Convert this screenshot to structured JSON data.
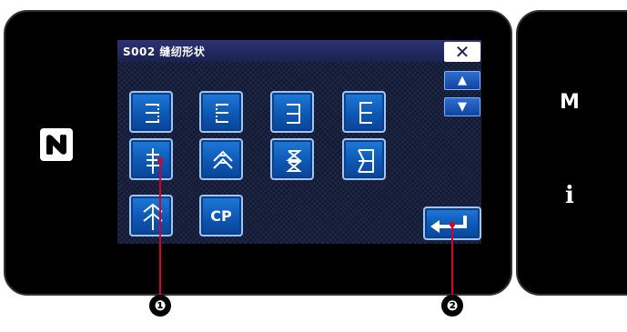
{
  "screen": {
    "title": "S002 缝纫形状",
    "close_label": "✕",
    "scroll_up": "▲",
    "scroll_down": "▼",
    "cp_label": "CP"
  },
  "patterns": [
    {
      "icon": "zigzag-pattern-1"
    },
    {
      "icon": "zigzag-pattern-2"
    },
    {
      "icon": "straight-bartack-pattern-1"
    },
    {
      "icon": "straight-bartack-pattern-2"
    },
    {
      "icon": "cross-bartack-pattern"
    },
    {
      "icon": "chevron-pattern"
    },
    {
      "icon": "double-triangle-pattern"
    },
    {
      "icon": "trapezoid-pattern"
    },
    {
      "icon": "arrow-pattern"
    },
    {
      "icon": "cp-pattern"
    }
  ],
  "side_keys": {
    "mode": "M",
    "info": "i"
  },
  "callouts": [
    "❶",
    "❷"
  ],
  "colors": {
    "screen_bg": "#121a36",
    "button_blue": "#0d58b5",
    "callout_red": "#d4002a"
  }
}
